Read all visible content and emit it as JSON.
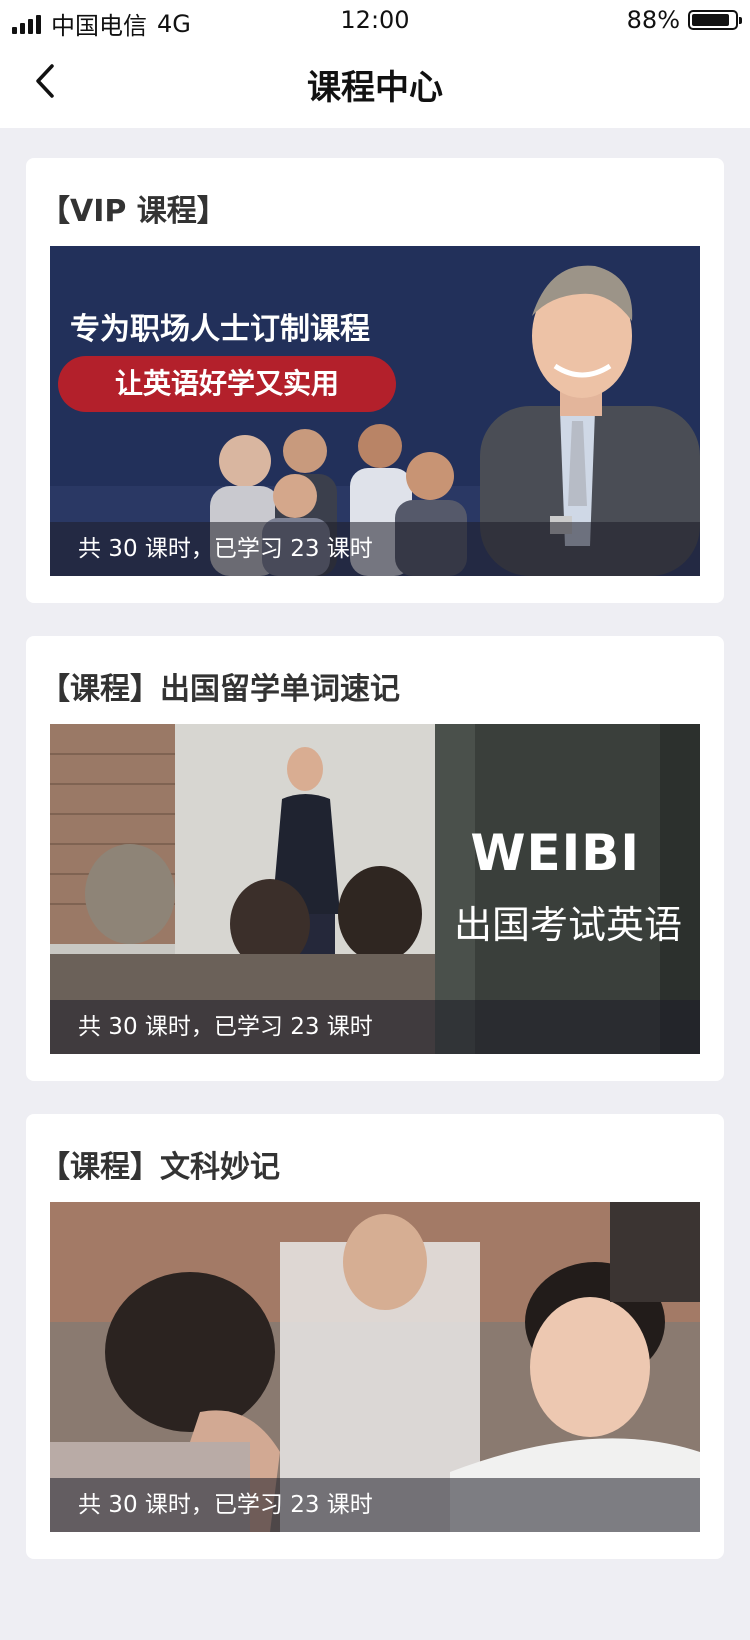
{
  "status_bar": {
    "carrier": "中国电信",
    "network": "4G",
    "time": "12:00",
    "battery": "88%",
    "battery_level": 0.88
  },
  "nav": {
    "title": "课程中心",
    "back_icon": "chevron-left-icon"
  },
  "courses": [
    {
      "title": "【VIP 课程】",
      "image_headline": "专为职场人士订制课程",
      "image_pill": "让英语好学又实用",
      "progress_text": "共 30 课时，已学习 23 课时"
    },
    {
      "title": "【课程】出国留学单词速记",
      "image_brand": "WEIBI",
      "image_subtitle": "出国考试英语",
      "progress_text": "共 30 课时，已学习 23 课时"
    },
    {
      "title": "【课程】文科妙记",
      "progress_text": "共 30 课时，已学习 23 课时"
    }
  ],
  "colors": {
    "background": "#eeeef3",
    "card": "#ffffff",
    "accent_red": "#b3202b",
    "banner_navy": "#22305a"
  }
}
